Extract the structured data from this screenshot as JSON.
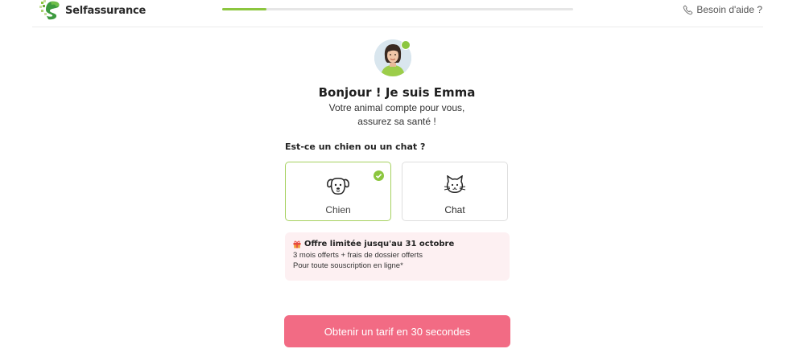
{
  "header": {
    "logo_text": "Selfassurance",
    "help_label": "Besoin d'aide ?",
    "progress_fraction": 0.125,
    "accent_color": "#8cc63f"
  },
  "assistant": {
    "title": "Bonjour ! Je suis Emma",
    "subtitle_line1": "Votre animal compte pour vous,",
    "subtitle_line2": "assurez sa santé !"
  },
  "form": {
    "question": "Est-ce un chien ou un chat ?",
    "options": [
      {
        "label": "Chien",
        "icon": "dog-icon",
        "selected": true
      },
      {
        "label": "Chat",
        "icon": "cat-icon",
        "selected": false
      }
    ]
  },
  "promo": {
    "title": "Offre limitée jusqu'au 31 octobre",
    "line1": "3 mois offerts + frais de dossier offerts",
    "line2": "Pour toute souscription en ligne*",
    "background": "#fdf0f2"
  },
  "cta": {
    "label": "Obtenir un tarif en 30 secondes",
    "color": "#f26b84"
  }
}
